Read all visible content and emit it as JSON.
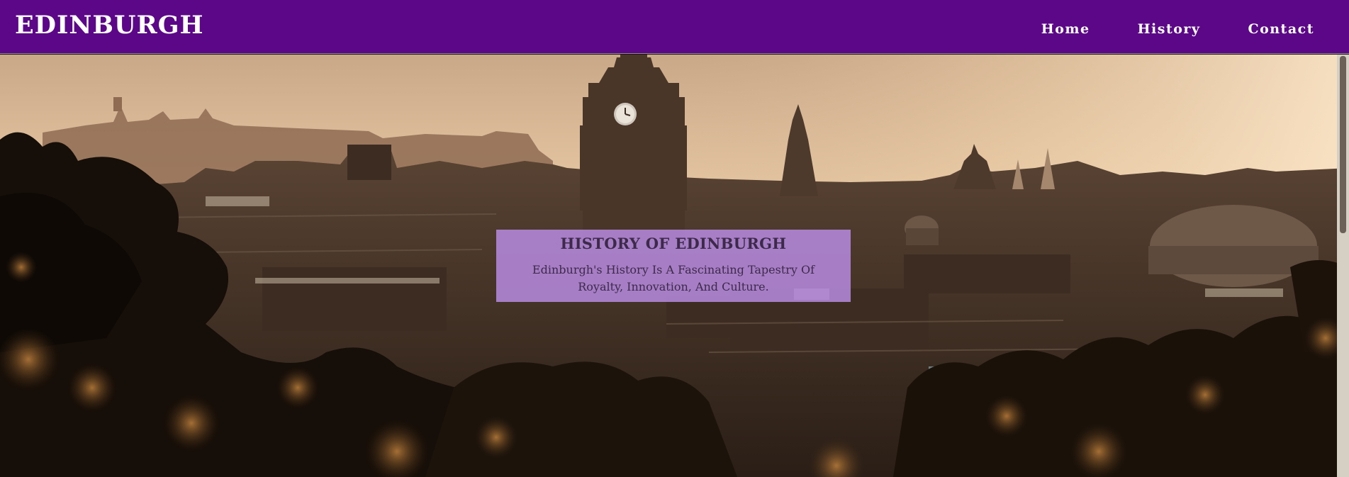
{
  "navbar": {
    "brand": "EDINBURGH",
    "links": [
      {
        "label": "Home"
      },
      {
        "label": "History"
      },
      {
        "label": "Contact"
      }
    ],
    "background_color": "#5c0787"
  },
  "hero": {
    "image_description_icon": "edinburgh-skyline-photo",
    "info_box": {
      "title": "HISTORY OF EDINBURGH",
      "text": "Edinburgh's History Is A Fascinating Tapestry Of Royalty, Innovation, And Culture.",
      "background_color": "#b78be0"
    }
  }
}
